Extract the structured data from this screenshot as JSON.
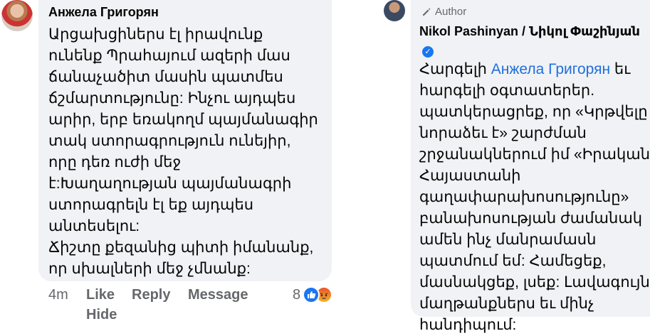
{
  "comment": {
    "author": "Анжела Григорян",
    "lines": [
      "Արցախցիներս էլ իրավունք",
      "ունենք Պրահայում ազերի մաս",
      "ճանաչածիտ մասին պատմես",
      "ճշմարտությունը: Ինչու այդպես",
      "արիր, երբ եռակողմ պայմանագիր",
      "տակ ստորագրություն ունեյիր,",
      "որը դեռ ուժի մեջ",
      "է:Խաղաղության պայմանագրի",
      "ստորագրելն էլ եք այդպես",
      "անտեսելու:",
      "Ճիշտը քեզանից պիտի իմանանք,",
      "որ սխալների մեջ չմնանք:"
    ],
    "actions": {
      "time": "4m",
      "like": "Like",
      "reply": "Reply",
      "message": "Message",
      "hide": "Hide"
    },
    "reaction_count": "8"
  },
  "reply": {
    "badge": "Author",
    "author": "Nikol Pashinyan / Նիկոլ Փաշինյան",
    "greeting": "Հարգելի",
    "mention": "Анжела Григорян",
    "after_mention": "եւ",
    "lines": [
      "հարգելի օգտատերեր.",
      "պատկերացրեք, որ «Կրթվելը",
      "նորաձեւ է» շարժման",
      "շրջանակներում իմ «Իրական",
      "Հայաստանի",
      "գաղափարախոսությունը»",
      "բանախոսության ժամանակ",
      "ամեն ինչ մանրամասն",
      "պատմում եմ: Համեցեք,",
      "մասնակցեք, լսեք: Լավագույն",
      "մաղթանքներս եւ մինչ",
      "հանդիպում:"
    ]
  },
  "colors": {
    "bubble": "#f0f2f5",
    "mention": "#216fdb",
    "meta": "#65676b",
    "like_blue": "#1877f2"
  }
}
